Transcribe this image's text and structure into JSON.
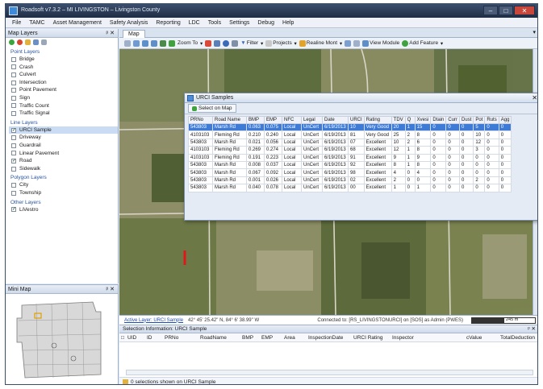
{
  "window": {
    "title": "Roadsoft v7.3.2 – MI LIVINGSTON – Livingston County",
    "buttons": {
      "minimize": "–",
      "maximize": "□",
      "close": "✕"
    }
  },
  "menu": [
    "File",
    "TAMC",
    "Asset Management",
    "Safety Analysis",
    "Reporting",
    "LDC",
    "Tools",
    "Settings",
    "Debug",
    "Help"
  ],
  "map_layers": {
    "header": "Map Layers",
    "pin": "ᵖ ✕",
    "groups": [
      {
        "name": "Point Layers",
        "layers": [
          {
            "label": "Bridge",
            "checked": false
          },
          {
            "label": "Crash",
            "checked": false
          },
          {
            "label": "Culvert",
            "checked": false
          },
          {
            "label": "Intersection",
            "checked": false
          },
          {
            "label": "Point Pavement",
            "checked": false
          },
          {
            "label": "Sign",
            "checked": false
          },
          {
            "label": "Traffic Count",
            "checked": false
          },
          {
            "label": "Traffic Signal",
            "checked": false
          }
        ]
      },
      {
        "name": "Line Layers",
        "layers": [
          {
            "label": "URCI Sample",
            "checked": true,
            "selected": true
          },
          {
            "label": "Driveway",
            "checked": false
          },
          {
            "label": "Guardrail",
            "checked": false
          },
          {
            "label": "Linear Pavement",
            "checked": false
          },
          {
            "label": "Road",
            "checked": true
          },
          {
            "label": "Sidewalk",
            "checked": false
          }
        ]
      },
      {
        "name": "Polygon Layers",
        "layers": [
          {
            "label": "City",
            "checked": false
          },
          {
            "label": "Township",
            "checked": false
          }
        ]
      },
      {
        "name": "Other Layers",
        "layers": [
          {
            "label": "LiVestro",
            "checked": true
          }
        ]
      }
    ]
  },
  "mini_map": {
    "header": "Mini Map",
    "pin": "ᵖ ✕"
  },
  "map_tab": {
    "label": "Map",
    "close": "▾"
  },
  "map_toolbar": {
    "zoom_to": "Zoom To",
    "filter": "Filter",
    "projects": "Projects",
    "realign": "Realine Mont",
    "view_module": "View Module",
    "add_feature": "Add Feature"
  },
  "urci_window": {
    "title": "URCI Samples",
    "close": "✕",
    "select_on_map": "Select on Map",
    "columns": [
      "PRNo",
      "Road Name",
      "BMP",
      "EMP",
      "NFC",
      "Legal",
      "Date",
      "URCI",
      "Rating",
      "TDV",
      "Q",
      "Xvesi",
      "Dtain",
      "Curr",
      "Dust",
      "Pot",
      "Ruts",
      "Agg"
    ],
    "rows": [
      [
        "543803",
        "Marsh Rd",
        "0.063",
        "0.075",
        "Local",
        "UnCert",
        "6/19/2013",
        "10",
        "Very Good",
        "20",
        "1",
        "15",
        "0",
        "0",
        "0",
        "5",
        "0",
        "0"
      ],
      [
        "4103103",
        "Fleming Rd",
        "0.210",
        "0.240",
        "Local",
        "UnCert",
        "6/19/2013",
        "81",
        "Very Good",
        "25",
        "2",
        "8",
        "0",
        "0",
        "0",
        "10",
        "0",
        "0"
      ],
      [
        "543803",
        "Marsh Rd",
        "0.021",
        "0.056",
        "Local",
        "UnCert",
        "6/19/2013",
        "07",
        "Excellent",
        "10",
        "2",
        "6",
        "0",
        "0",
        "0",
        "12",
        "0",
        "0"
      ],
      [
        "4103103",
        "Fleming Rd",
        "0.269",
        "0.274",
        "Local",
        "UnCert",
        "6/19/2013",
        "68",
        "Excellent",
        "12",
        "1",
        "8",
        "0",
        "0",
        "0",
        "3",
        "0",
        "0"
      ],
      [
        "4103103",
        "Fleming Rd",
        "0.191",
        "0.223",
        "Local",
        "UnCert",
        "6/19/2013",
        "91",
        "Excellent",
        "9",
        "1",
        "9",
        "0",
        "0",
        "0",
        "0",
        "0",
        "0"
      ],
      [
        "543803",
        "Marsh Rd",
        "0.008",
        "0.037",
        "Local",
        "UnCert",
        "6/19/2013",
        "92",
        "Excellent",
        "8",
        "1",
        "8",
        "0",
        "0",
        "0",
        "0",
        "0",
        "0"
      ],
      [
        "543803",
        "Marsh Rd",
        "0.067",
        "0.092",
        "Local",
        "UnCert",
        "6/19/2013",
        "98",
        "Excellent",
        "4",
        "0",
        "4",
        "0",
        "0",
        "0",
        "0",
        "0",
        "0"
      ],
      [
        "543803",
        "Marsh Rd",
        "0.001",
        "0.026",
        "Local",
        "UnCert",
        "6/19/2013",
        "02",
        "Excellent",
        "2",
        "0",
        "0",
        "0",
        "0",
        "0",
        "2",
        "0",
        "0"
      ],
      [
        "543803",
        "Marsh Rd",
        "0.040",
        "0.078",
        "Local",
        "UnCert",
        "6/19/2013",
        "00",
        "Excellent",
        "1",
        "0",
        "1",
        "0",
        "0",
        "0",
        "0",
        "0",
        "0"
      ]
    ]
  },
  "status": {
    "active_layer": "Active Layer: URCI Sample",
    "coords": "42° 45' 25.42\" N, 84° 6' 38.99\" W",
    "connection": "Connected to: [RS_LIVINGSTONURCI] on [SOS] as Admin (PWES)",
    "scale": "245 m"
  },
  "selection": {
    "header": "Selection Information: URCI Sample",
    "pin": "ᵖ ✕",
    "columns": [
      "UID",
      "ID",
      "PRNo",
      "RoadName",
      "BMP",
      "EMP",
      "Area",
      "InspectionDate",
      "URCI Rating",
      "Inspector",
      "cValue",
      "TotalDeduction"
    ],
    "footer": "0 selections shown on URCI Sample"
  }
}
